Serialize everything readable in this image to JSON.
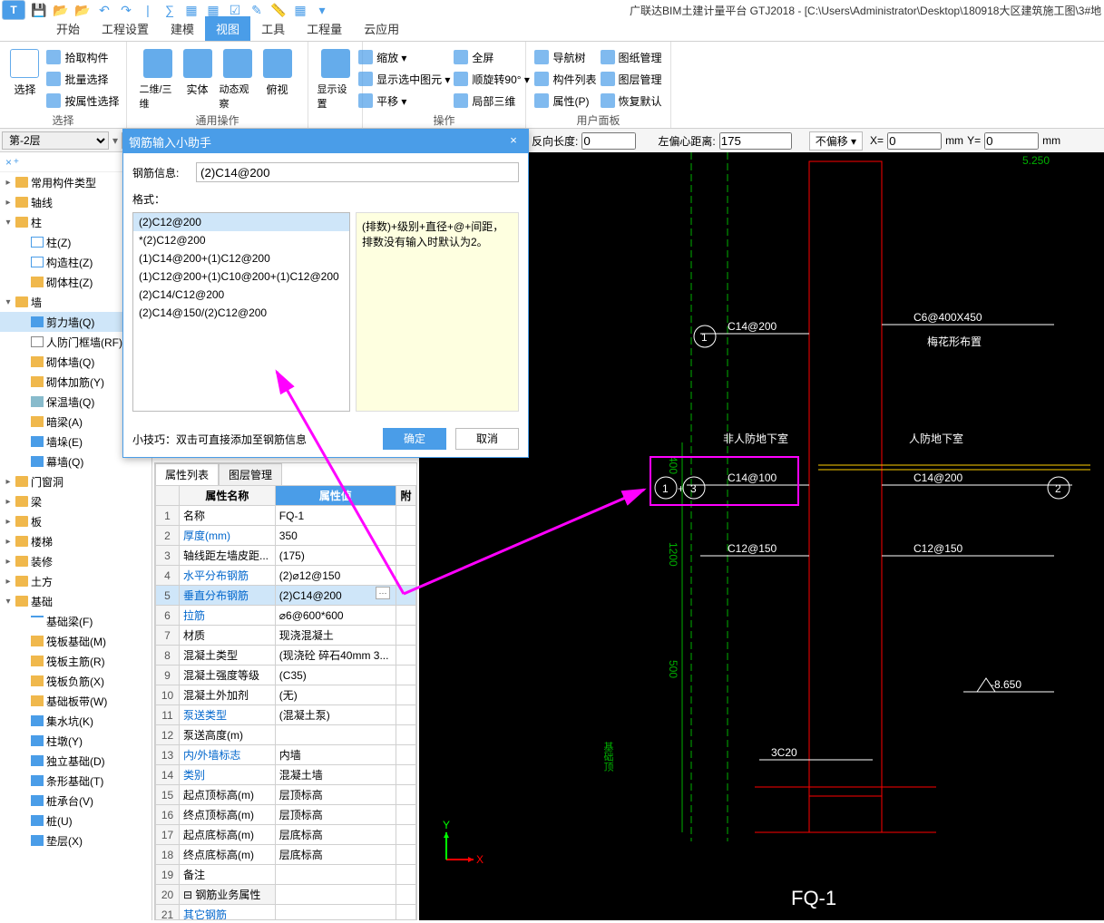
{
  "title": "广联达BIM土建计量平台 GTJ2018 - [C:\\Users\\Administrator\\Desktop\\180918大区建筑施工图\\3#地",
  "ribbon_tabs": [
    "开始",
    "工程设置",
    "建模",
    "视图",
    "工具",
    "工程量",
    "云应用"
  ],
  "active_ribbon_tab": "视图",
  "ribbon": {
    "select_label": "选择",
    "select_btn": "选择",
    "pick": "拾取构件",
    "batch": "批量选择",
    "byprop": "按属性选择",
    "generic_label": "通用操作",
    "twothree": "二维/三维",
    "solid": "实体",
    "dynview": "动态观察",
    "bird": "俯视",
    "dispset": "显示设置",
    "op_label": "操作",
    "zoom": "缩放 ▾",
    "full": "全屏",
    "rotate": "顺旋转90° ▾",
    "showsel": "显示选中图元 ▾",
    "pan": "平移 ▾",
    "local3d": "局部三维",
    "userpanel_label": "用户面板",
    "navtree": "导航树",
    "drawmgr": "图纸管理",
    "complist": "构件列表",
    "layermgr": "图层管理",
    "props": "属性(P)",
    "restore": "恢复默认"
  },
  "floor": "第-2层",
  "cadbar": {
    "revlen": "反向长度:",
    "revlen_v": "0",
    "leftoff": "左偏心距离:",
    "leftoff_v": "175",
    "nooffset": "不偏移 ▾",
    "x": "X= ",
    "xv": "0",
    "mm": "mm",
    "y": "Y= ",
    "yv": "0"
  },
  "tree": {
    "common": "常用构件类型",
    "axis": "轴线",
    "col": "柱",
    "colz": "柱(Z)",
    "struct": "构造柱(Z)",
    "mas": "砌体柱(Z)",
    "wall": "墙",
    "shear": "剪力墙(Q)",
    "civildoor": "人防门框墙(RF)",
    "maswall": "砌体墙(Q)",
    "masrein": "砌体加筋(Y)",
    "insul": "保温墙(Q)",
    "darkbeam": "暗梁(A)",
    "wallpad": "墙垛(E)",
    "curtain": "幕墙(Q)",
    "door": "门窗洞",
    "beam": "梁",
    "slab": "板",
    "stair": "楼梯",
    "deco": "装修",
    "earth": "土方",
    "found": "基础",
    "fbeam": "基础梁(F)",
    "raft": "筏板基础(M)",
    "raftmain": "筏板主筋(R)",
    "raftneg": "筏板负筋(X)",
    "fstrip": "基础板带(W)",
    "sump": "集水坑(K)",
    "pier": "柱墩(Y)",
    "isolated": "独立基础(D)",
    "strip": "条形基础(T)",
    "pilecap": "桩承台(V)",
    "pile": "桩(U)",
    "cushion": "垫层(X)"
  },
  "dialog": {
    "title": "钢筋输入小助手",
    "info_label": "钢筋信息:",
    "info_value": "(2)C14@200",
    "format_label": "格式：",
    "formats": [
      "(2)C12@200",
      "*(2)C12@200",
      "(1)C14@200+(1)C12@200",
      "(1)C12@200+(1)C10@200+(1)C12@200",
      "(2)C14/C12@200",
      "(2)C14@150/(2)C12@200"
    ],
    "format_selected": 0,
    "hint": "(排数)+级别+直径+@+间距，排数没有输入时默认为2。",
    "tip": "小技巧：双击可直接添加至钢筋信息",
    "ok": "确定",
    "cancel": "取消"
  },
  "prop": {
    "tab_list": "属性列表",
    "tab_layer": "图层管理",
    "col_name": "属性名称",
    "col_val": "属性值",
    "col_att": "附",
    "rows": [
      {
        "n": "1",
        "name": "名称",
        "val": "FQ-1"
      },
      {
        "n": "2",
        "name": "厚度(mm)",
        "val": "350",
        "link": true
      },
      {
        "n": "3",
        "name": "轴线距左墙皮距...",
        "val": "(175)"
      },
      {
        "n": "4",
        "name": "水平分布钢筋",
        "val": "(2)⌀12@150",
        "link": true
      },
      {
        "n": "5",
        "name": "垂直分布钢筋",
        "val": "(2)C14@200",
        "link": true,
        "hl": true
      },
      {
        "n": "6",
        "name": "拉筋",
        "val": "⌀6@600*600",
        "link": true
      },
      {
        "n": "7",
        "name": "材质",
        "val": "现浇混凝土"
      },
      {
        "n": "8",
        "name": "混凝土类型",
        "val": "(现浇砼 碎石40mm 3..."
      },
      {
        "n": "9",
        "name": "混凝土强度等级",
        "val": "(C35)"
      },
      {
        "n": "10",
        "name": "混凝土外加剂",
        "val": "(无)"
      },
      {
        "n": "11",
        "name": "泵送类型",
        "val": "(混凝土泵)",
        "link": true
      },
      {
        "n": "12",
        "name": "泵送高度(m)",
        "val": ""
      },
      {
        "n": "13",
        "name": "内/外墙标志",
        "val": "内墙",
        "link": true
      },
      {
        "n": "14",
        "name": "类别",
        "val": "混凝土墙",
        "link": true
      },
      {
        "n": "15",
        "name": "起点顶标高(m)",
        "val": "层顶标高"
      },
      {
        "n": "16",
        "name": "终点顶标高(m)",
        "val": "层顶标高"
      },
      {
        "n": "17",
        "name": "起点底标高(m)",
        "val": "层底标高"
      },
      {
        "n": "18",
        "name": "终点底标高(m)",
        "val": "层底标高"
      },
      {
        "n": "19",
        "name": "备注",
        "val": ""
      },
      {
        "n": "20",
        "name": "⊟ 钢筋业务属性",
        "val": "",
        "grp": true
      },
      {
        "n": "21",
        "name": "  其它钢筋",
        "val": "",
        "link": true
      }
    ]
  },
  "cad_labels": {
    "c14_200": "C14@200",
    "c6": "C6@400X450",
    "meihua": "梅花形布置",
    "feirenfang": "非人防地下室",
    "renfang": "人防地下室",
    "c14_100": "C14@100",
    "c14_200b": "C14@200",
    "c12_150": "C12@150",
    "c12_150b": "C12@150",
    "tag3c20": "3C20",
    "fq1": "FQ-1",
    "neg8": "-8.650",
    "dim400": "400",
    "dim1200": "1200",
    "dim500": "500",
    "topnum": "5.250",
    "jbcy": "基础顶"
  }
}
